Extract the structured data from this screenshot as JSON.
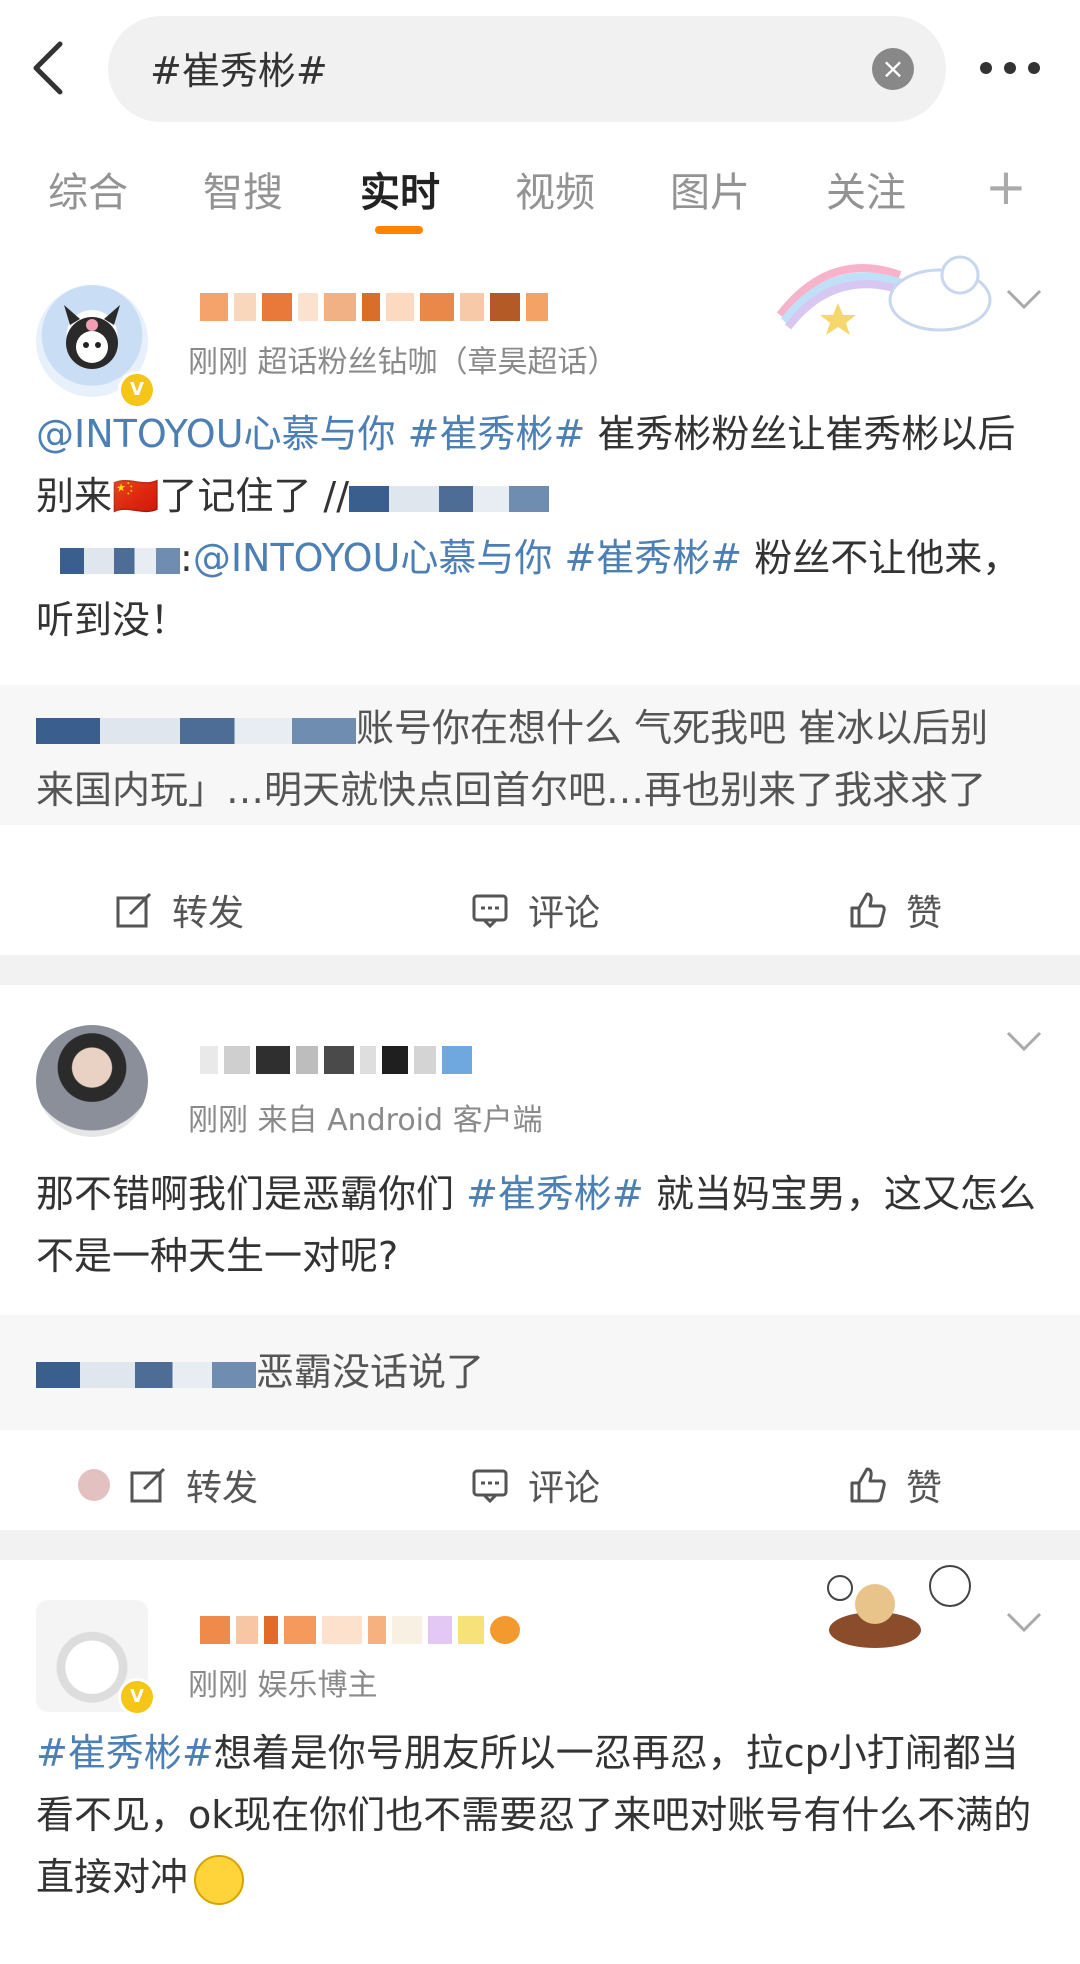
{
  "search": {
    "query": "#崔秀彬#"
  },
  "tabs": [
    "综合",
    "智搜",
    "实时",
    "视频",
    "图片",
    "关注"
  ],
  "actions": {
    "repost": "转发",
    "comment": "评论",
    "like": "赞"
  },
  "posts": [
    {
      "meta": "刚刚  超话粉丝钻咖（章昊超话）",
      "mention": "@INTOYOU心慕与你",
      "hashtag": "#崔秀彬#",
      "text1": " 崔秀彬粉丝让崔秀彬以后别来",
      "flag": "🇨🇳",
      "text2": "了记住了 //",
      "text3": ":",
      "text4": " 粉丝不让他来，听到没！",
      "quote_line1": "账号你在想什么 气死我吧 崔冰以后别",
      "quote_line2": "来国内玩」…明天就快点回首尔吧…再也别来了我求求了"
    },
    {
      "meta": "刚刚  来自 Android 客户端",
      "text1": "那不错啊我们是恶霸你们 ",
      "hashtag": "#崔秀彬#",
      "text2": " 就当妈宝男，这又怎么不是一种天生一对呢?",
      "quote": "恶霸没话说了"
    },
    {
      "meta": "刚刚  娱乐博主",
      "hashtag": "#崔秀彬#",
      "text": "想着是你号朋友所以一忍再忍，拉cp小打闹都当看不见，ok现在你们也不需要忍了来吧对账号有什么不满的直接对冲",
      "emoji": "🙂"
    }
  ]
}
